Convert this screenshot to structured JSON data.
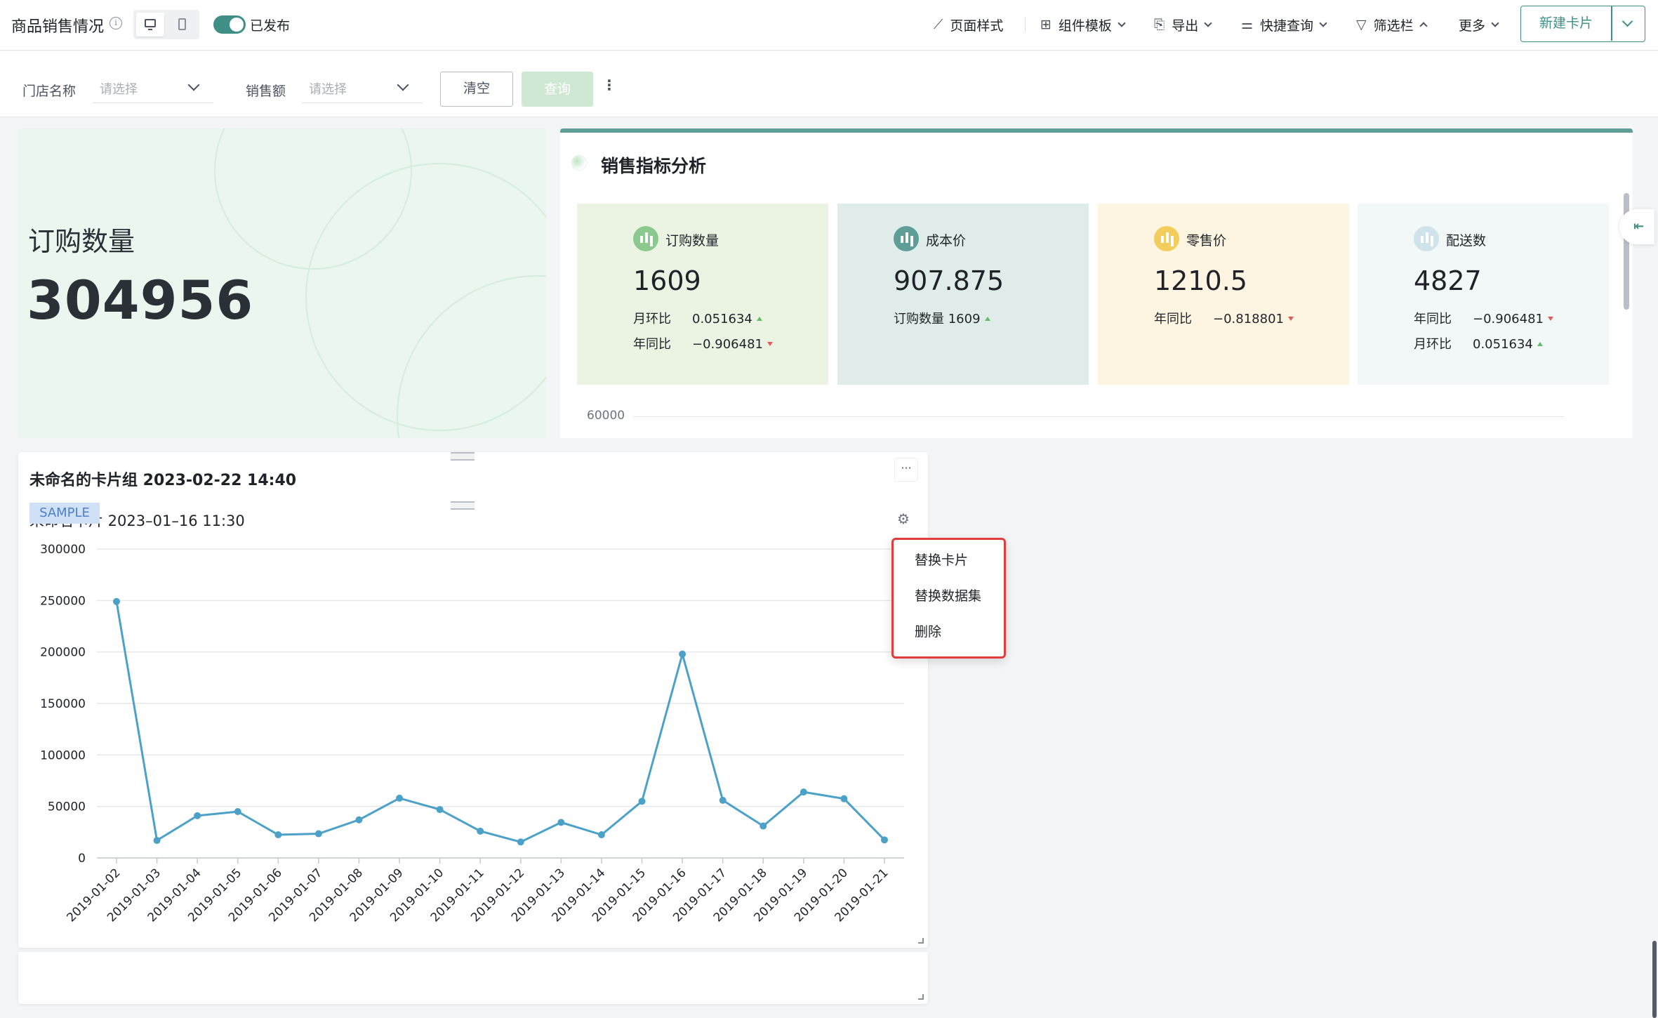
{
  "header": {
    "title": "商品销售情况",
    "publish_label": "已发布",
    "menu": {
      "page_style": "页面样式",
      "component_template": "组件模板",
      "export": "导出",
      "quick_query": "快捷查询",
      "filter_bar": "筛选栏",
      "more": "更多"
    },
    "new_card": "新建卡片"
  },
  "filters": {
    "store_label": "门店名称",
    "store_placeholder": "请选择",
    "sales_label": "销售额",
    "sales_placeholder": "请选择",
    "clear": "清空",
    "query": "查询"
  },
  "kpi": {
    "title": "订购数量",
    "value": "304956"
  },
  "sales_panel": {
    "title": "销售指标分析",
    "metrics": [
      {
        "label": "订购数量",
        "value": "1609",
        "color": "#8cc98f",
        "bg": "#ebf4e3",
        "rows": [
          {
            "k": "月环比",
            "v": "0.051634",
            "trend": "up"
          },
          {
            "k": "年同比",
            "v": "−0.906481",
            "trend": "down"
          }
        ]
      },
      {
        "label": "成本价",
        "value": "907.875",
        "color": "#5e9e96",
        "bg": "#e0ecea",
        "rows": [
          {
            "k": "订购数量",
            "v": "1609",
            "trend": "up"
          }
        ]
      },
      {
        "label": "零售价",
        "value": "1210.5",
        "color": "#f2cd5c",
        "bg": "#fdf5e1",
        "rows": [
          {
            "k": "年同比",
            "v": "−0.818801",
            "trend": "down"
          }
        ]
      },
      {
        "label": "配送数",
        "value": "4827",
        "color": "#cfe3ea",
        "bg": "#f2f8f8",
        "rows": [
          {
            "k": "年同比",
            "v": "−0.906481",
            "trend": "down"
          },
          {
            "k": "月环比",
            "v": "0.051634",
            "trend": "up"
          }
        ]
      }
    ],
    "axis_label": "60000"
  },
  "card_group": {
    "title": "未命名的卡片组 2023-02-22 14:40",
    "inner_title": "未命名卡片 2023–01–16 11:30",
    "sample_tag": "SAMPLE"
  },
  "context_menu": {
    "items": [
      "替换卡片",
      "替换数据集",
      "删除"
    ]
  },
  "chart_data": {
    "type": "line",
    "x": [
      "2019-01-02",
      "2019-01-03",
      "2019-01-04",
      "2019-01-05",
      "2019-01-06",
      "2019-01-07",
      "2019-01-08",
      "2019-01-09",
      "2019-01-10",
      "2019-01-11",
      "2019-01-12",
      "2019-01-13",
      "2019-01-14",
      "2019-01-15",
      "2019-01-16",
      "2019-01-17",
      "2019-01-18",
      "2019-01-19",
      "2019-01-20",
      "2019-01-21"
    ],
    "values": [
      249000,
      17000,
      41000,
      45000,
      22500,
      23500,
      37000,
      58000,
      47000,
      26000,
      15500,
      34500,
      22500,
      55000,
      198000,
      56000,
      31000,
      64000,
      57500,
      17500
    ],
    "yticks": [
      0,
      50000,
      100000,
      150000,
      200000,
      250000,
      300000
    ],
    "ylim": [
      0,
      300000
    ],
    "color": "#4ba1c8",
    "grid": true
  }
}
